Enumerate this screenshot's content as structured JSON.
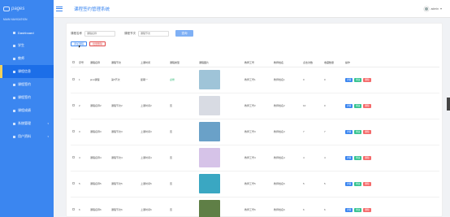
{
  "app": {
    "logo_text": "pages",
    "title": "课程签约管理系统"
  },
  "user": {
    "name": "admin"
  },
  "sidebar": {
    "header": "MAIN NAVIGATION",
    "items": [
      {
        "label": "Dashboard",
        "active": false,
        "has_children": false
      },
      {
        "label": "学生",
        "active": false,
        "has_children": false
      },
      {
        "label": "教师",
        "active": false,
        "has_children": false
      },
      {
        "label": "课程信息",
        "active": true,
        "has_children": false
      },
      {
        "label": "课程签约",
        "active": false,
        "has_children": false
      },
      {
        "label": "课程签约",
        "active": false,
        "has_children": false
      },
      {
        "label": "课程成绩",
        "active": false,
        "has_children": false
      },
      {
        "label": "系统管理",
        "active": false,
        "has_children": true
      },
      {
        "label": "用户资料",
        "active": false,
        "has_children": true
      }
    ]
  },
  "filters": {
    "name_label": "课程名称",
    "name_placeholder": "课程名称",
    "type_label": "课程节次",
    "type_placeholder": "课程节次",
    "search_btn": "查询"
  },
  "actions": {
    "add": "添加课程",
    "delete": "批量删除"
  },
  "table": {
    "columns": [
      "序号",
      "课程名称",
      "课程节次",
      "上课时间",
      "课程类型",
      "课程图片",
      "教师工号",
      "教师姓名",
      "点击次数",
      "收藏数量",
      "操作"
    ],
    "rows": [
      {
        "idx": "1",
        "name": "java课程",
        "section": "第5节次",
        "time": "星期一",
        "type": "必修",
        "type_green": true,
        "cover_color": "#9fc4d8",
        "tid": "教师工号1",
        "tname": "教师姓名1",
        "clicks": "0",
        "fav": "0"
      },
      {
        "idx": "2",
        "name": "课程名称2",
        "section": "课程节次2",
        "time": "上课时间2",
        "type": "否",
        "type_green": false,
        "cover_color": "#d8dbe3",
        "tid": "教师工号2",
        "tname": "教师姓名2",
        "clicks": "10",
        "fav": "0"
      },
      {
        "idx": "3",
        "name": "课程名称3",
        "section": "课程节次3",
        "time": "上课时间3",
        "type": "否",
        "type_green": false,
        "cover_color": "#6aa1c8",
        "tid": "教师工号3",
        "tname": "教师姓名3",
        "clicks": "7",
        "fav": "7"
      },
      {
        "idx": "4",
        "name": "课程名称4",
        "section": "课程节次4",
        "time": "上课时间4",
        "type": "否",
        "type_green": false,
        "cover_color": "#d6c3e8",
        "tid": "教师工号4",
        "tname": "教师姓名4",
        "clicks": "4",
        "fav": "4"
      },
      {
        "idx": "5",
        "name": "课程名称5",
        "section": "课程节次5",
        "time": "上课时间5",
        "type": "否",
        "type_green": false,
        "cover_color": "#3aa7c2",
        "tid": "教师工号5",
        "tname": "教师姓名5",
        "clicks": "5",
        "fav": "5"
      },
      {
        "idx": "6",
        "name": "课程名称6",
        "section": "课程节次6",
        "time": "上课时间6",
        "type": "否",
        "type_green": false,
        "cover_color": "#5f7f46",
        "tid": "教师工号6",
        "tname": "教师姓名6",
        "clicks": "6",
        "fav": "6"
      }
    ],
    "row_actions": {
      "view": "详情",
      "edit": "修改",
      "delete": "删除"
    }
  }
}
